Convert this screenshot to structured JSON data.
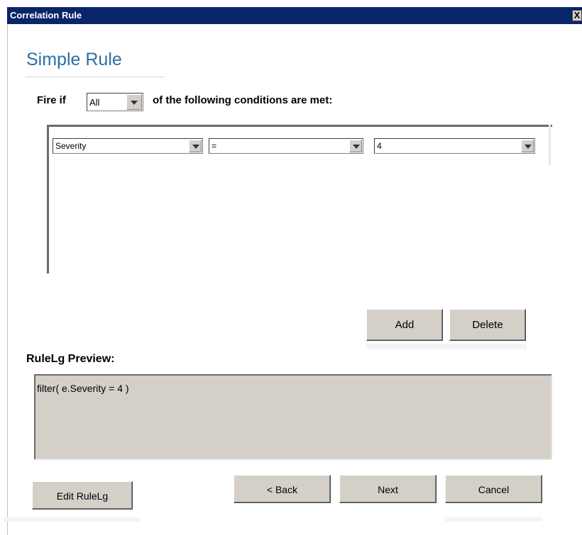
{
  "window": {
    "title": "Correlation Rule",
    "close_glyph": "X"
  },
  "heading": "Simple Rule",
  "fire": {
    "prefix": "Fire if",
    "selected": "All",
    "suffix": "of the following conditions are met:"
  },
  "condition": {
    "field": "Severity",
    "operator": "=",
    "value": "4"
  },
  "buttons": {
    "add": "Add",
    "delete": "Delete",
    "edit": "Edit RuleLg",
    "back": "< Back",
    "next": "Next",
    "cancel": "Cancel"
  },
  "preview": {
    "label": "RuleLg Preview:",
    "text": "filter( e.Severity = 4 )"
  },
  "colors": {
    "titlebar": "#0a246a",
    "heading": "#2b70a6",
    "button_face": "#d4d0c8"
  }
}
